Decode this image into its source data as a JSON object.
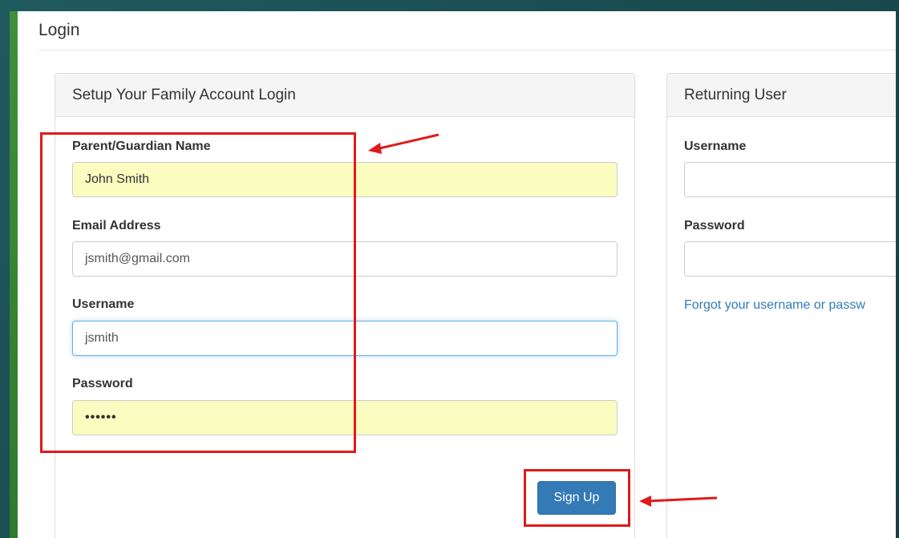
{
  "page": {
    "title": "Login"
  },
  "signup_panel": {
    "heading": "Setup Your Family Account Login",
    "fields": {
      "name_label": "Parent/Guardian Name",
      "name_value": "John Smith",
      "email_label": "Email Address",
      "email_value": "jsmith@gmail.com",
      "username_label": "Username",
      "username_value": "jsmith",
      "password_label": "Password",
      "password_value": "••••••"
    },
    "submit_label": "Sign Up"
  },
  "returning_panel": {
    "heading": "Returning User",
    "username_label": "Username",
    "username_value": "",
    "password_label": "Password",
    "password_value": "",
    "forgot_link": "Forgot your username or passw"
  },
  "annotations": {
    "highlight_color": "#e01a1a"
  },
  "colors": {
    "primary": "#337ab7",
    "autofill": "#fafcc0",
    "focus": "#66afe9"
  }
}
